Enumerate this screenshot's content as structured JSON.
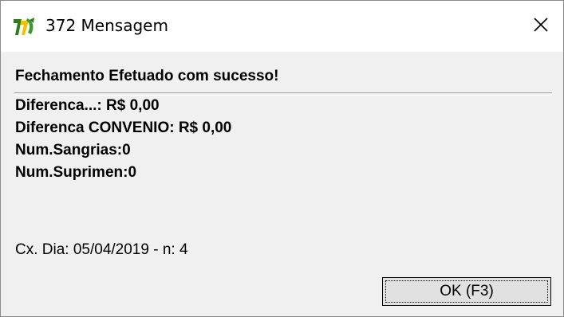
{
  "window": {
    "title": "372 Mensagem",
    "icon": "app-logo-icon",
    "close_icon": "close-icon"
  },
  "message": {
    "headline": "Fechamento Efetuado com sucesso!",
    "details": [
      "Diferenca...: R$ 0,00",
      "Diferenca CONVENIO: R$ 0,00",
      "Num.Sangrias:0",
      "Num.Suprimen:0"
    ],
    "footer": "Cx. Dia: 05/04/2019 - n: 4"
  },
  "buttons": {
    "ok_label": "OK (F3)"
  }
}
